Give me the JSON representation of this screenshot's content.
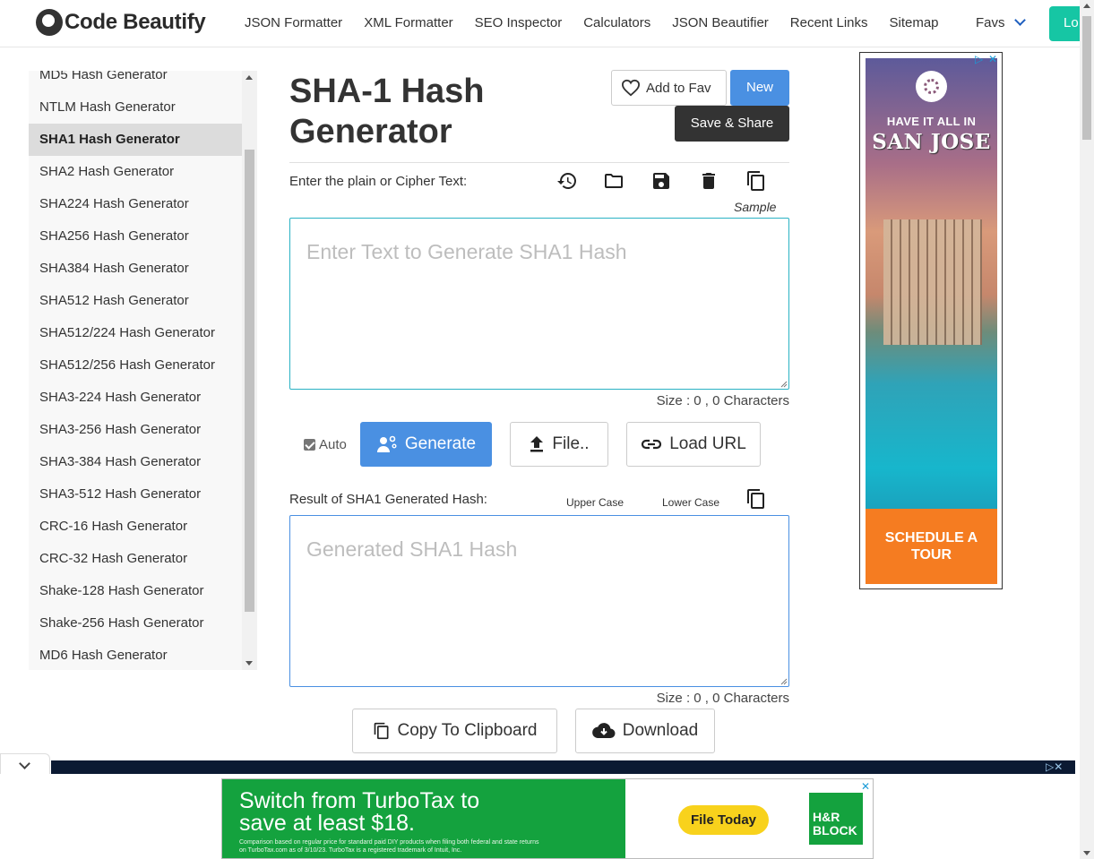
{
  "nav": {
    "logo_text": "Code Beautify",
    "links": [
      "JSON Formatter",
      "XML Formatter",
      "SEO Inspector",
      "Calculators",
      "JSON Beautifier",
      "Recent Links",
      "Sitemap"
    ],
    "favs_label": "Favs",
    "login_label": "Lo"
  },
  "sidebar": {
    "items": [
      "MD5 Hash Generator",
      "NTLM Hash Generator",
      "SHA1 Hash Generator",
      "SHA2 Hash Generator",
      "SHA224 Hash Generator",
      "SHA256 Hash Generator",
      "SHA384 Hash Generator",
      "SHA512 Hash Generator",
      "SHA512/224 Hash Generator",
      "SHA512/256 Hash Generator",
      "SHA3-224 Hash Generator",
      "SHA3-256 Hash Generator",
      "SHA3-384 Hash Generator",
      "SHA3-512 Hash Generator",
      "CRC-16 Hash Generator",
      "CRC-32 Hash Generator",
      "Shake-128 Hash Generator",
      "Shake-256 Hash Generator",
      "MD6 Hash Generator"
    ],
    "active_index": 2
  },
  "main": {
    "title": "SHA-1 Hash Generator",
    "add_to_fav_label": "Add to Fav",
    "new_label": "New",
    "save_share_label": "Save & Share",
    "input_label": "Enter the plain or Cipher Text:",
    "sample_label": "Sample",
    "input_placeholder": "Enter Text to Generate SHA1 Hash",
    "input_value": "",
    "input_size": "Size : 0 , 0 Characters",
    "auto_label": "Auto",
    "auto_checked": true,
    "generate_label": "Generate",
    "file_label": "File..",
    "load_url_label": "Load URL",
    "result_label": "Result of SHA1 Generated Hash:",
    "upper_case_label": "Upper Case",
    "lower_case_label": "Lower Case",
    "output_placeholder": "Generated SHA1 Hash",
    "output_value": "",
    "output_size": "Size : 0 , 0 Characters",
    "copy_label": "Copy To Clipboard",
    "download_label": "Download"
  },
  "ads": {
    "right": {
      "tagline": "HAVE IT ALL IN",
      "city": "SAN JOSE",
      "cta": "SCHEDULE A TOUR"
    },
    "bottom": {
      "headline": "Switch from TurboTax to save at least $18.",
      "fine_print": "Comparison based on regular price for standard paid DIY products when filing both federal and state returns on TurboTax.com as of 3/10/23. TurboTax is a registered trademark of Intuit, Inc.",
      "cta": "File Today",
      "brand": "H&R BLOCK"
    }
  },
  "colors": {
    "primary": "#4a90e2",
    "dark_button": "#333333",
    "accent_green": "#16c6a4",
    "input_border": "#2ab2c4",
    "ad_green": "#14a23e",
    "ad_orange": "#f57c21"
  }
}
